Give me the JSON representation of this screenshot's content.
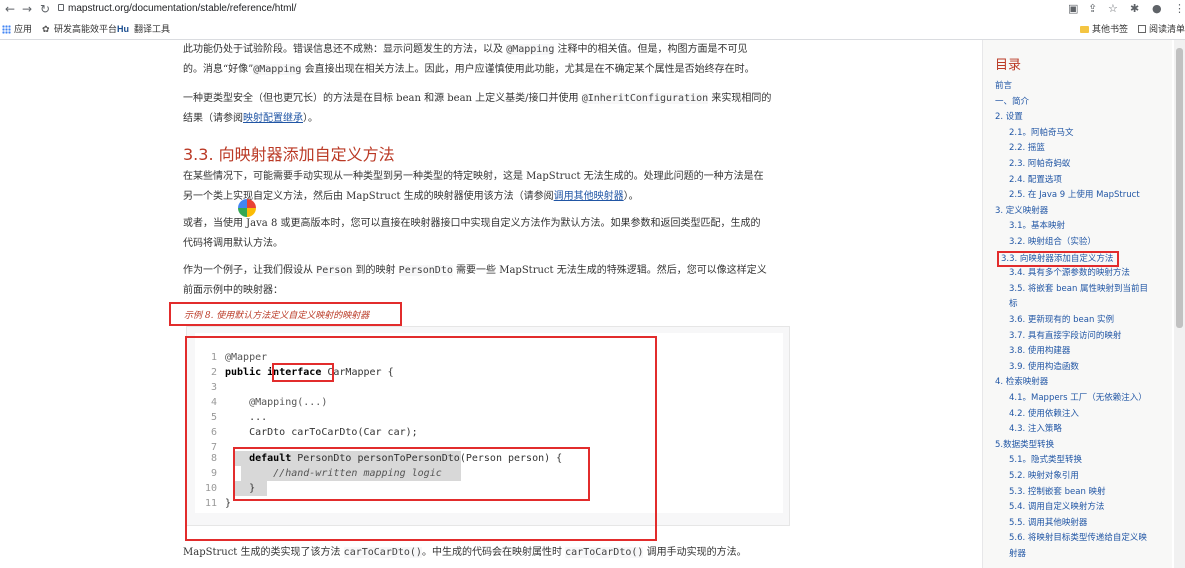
{
  "browser": {
    "url": "mapstruct.org/documentation/stable/reference/html/",
    "bookmarks": [
      "应用",
      "研发高能效平台",
      "Hu",
      "翻译工具"
    ],
    "bookmarks_right": [
      "其他书签",
      "阅读清单"
    ]
  },
  "content": {
    "para1_line1_a": "此功能仍处于试验阶段。错误信息还不成熟：显示问题发生的方法，以及 ",
    "para1_code1": "@Mapping",
    "para1_line1_b": " 注释中的相关值。但是，构图方面是不可见",
    "para1_line2_a": "的。消息“好像”",
    "para1_code2": "@Mapping",
    "para1_line2_b": " 会直接出现在相关方法上。因此，用户应谨慎使用此功能，尤其是在不确定某个属性是否始终存在时。",
    "para2_line1_a": "一种更类型安全（但也更冗长）的方法是在目标 bean 和源 bean 上定义基类/接口并使用 ",
    "para2_code": "@InheritConfiguration",
    "para2_line1_b": " 来实现相同的",
    "para2_line2_a": "结果（请参阅",
    "para2_link": "映射配置继承",
    "para2_line2_b": "）。",
    "heading": "3.3. 向映射器添加自定义方法",
    "para3_line1": "在某些情况下，可能需要手动实现从一种类型到另一种类型的特定映射，这是 MapStruct 无法生成的。处理此问题的一种方法是在",
    "para3_line2_a": "另一个类上实现自定义方法，然后由 MapStruct 生成的映射器使用该方法（请参阅",
    "para3_link": "调用其他映射器",
    "para3_line2_b": "）。",
    "para4_line1": "或者，当使用 Java 8 或更高版本时，您可以直接在映射器接口中实现自定义方法作为默认方法。如果参数和返回类型匹配，生成的",
    "para4_line2": "代码将调用默认方法。",
    "para5_line1_a": "作为一个例子，让我们假设从 ",
    "para5_code1": "Person",
    "para5_line1_b": " 到的映射 ",
    "para5_code2": "PersonDto",
    "para5_line1_c": " 需要一些 MapStruct 无法生成的特殊逻辑。然后，您可以像这样定义",
    "para5_line2": "前面示例中的映射器：",
    "example_title": "示例 8. 使用默认方法定义自定义映射的映射器",
    "code_lines": [
      {
        "n": "1",
        "t": "@Mapper"
      },
      {
        "n": "2",
        "a": "public ",
        "k": "interface",
        "b": " CarMapper {"
      },
      {
        "n": "3",
        "t": ""
      },
      {
        "n": "4",
        "t": "    @Mapping(...)"
      },
      {
        "n": "5",
        "t": "    ..."
      },
      {
        "n": "6",
        "t": "    CarDto carToCarDto(Car car);"
      },
      {
        "n": "7",
        "t": ""
      },
      {
        "n": "8",
        "a": "    ",
        "k": "default",
        "b": " PersonDto personToPersonDto(Person person) {"
      },
      {
        "n": "9",
        "c": "        //hand-written mapping logic"
      },
      {
        "n": "10",
        "t": "    }"
      },
      {
        "n": "11",
        "t": "}"
      }
    ],
    "para6_a": "MapStruct 生成的类实现了该方法 ",
    "para6_code1": "carToCarDto()",
    "para6_b": "。中生成的代码会在映射属性时 ",
    "para6_code2": "carToCarDto()",
    "para6_c": " 调用手动实现的方法。"
  },
  "toc": {
    "title": "目录",
    "items": [
      {
        "label": "前言",
        "level": 0
      },
      {
        "label": "一、简介",
        "level": 0
      },
      {
        "label": "2. 设置",
        "level": 0
      },
      {
        "label": "2.1。阿帕奇马文",
        "level": 1
      },
      {
        "label": "2.2. 摇篮",
        "level": 1
      },
      {
        "label": "2.3. 阿帕奇蚂蚁",
        "level": 1
      },
      {
        "label": "2.4. 配置选项",
        "level": 1
      },
      {
        "label": "2.5. 在 Java 9 上使用 MapStruct",
        "level": 1
      },
      {
        "label": "3. 定义映射器",
        "level": 0
      },
      {
        "label": "3.1。基本映射",
        "level": 1
      },
      {
        "label": "3.2. 映射组合（实验）",
        "level": 1
      },
      {
        "label": "3.3. 向映射器添加自定义方法",
        "level": 1,
        "active": true
      },
      {
        "label": "3.4. 具有多个源参数的映射方法",
        "level": 1
      },
      {
        "label": "3.5. 将嵌套 bean 属性映射到当前目",
        "level": 1
      },
      {
        "label": "标",
        "level": 1
      },
      {
        "label": "3.6. 更新现有的 bean 实例",
        "level": 1
      },
      {
        "label": "3.7. 具有直接字段访问的映射",
        "level": 1
      },
      {
        "label": "3.8. 使用构建器",
        "level": 1
      },
      {
        "label": "3.9. 使用构造函数",
        "level": 1
      },
      {
        "label": "4. 检索映射器",
        "level": 0
      },
      {
        "label": "4.1。Mappers 工厂（无依赖注入）",
        "level": 1
      },
      {
        "label": "4.2. 使用依赖注入",
        "level": 1
      },
      {
        "label": "4.3. 注入策略",
        "level": 1
      },
      {
        "label": "5.数据类型转换",
        "level": 0
      },
      {
        "label": "5.1。隐式类型转换",
        "level": 1
      },
      {
        "label": "5.2. 映射对象引用",
        "level": 1
      },
      {
        "label": "5.3. 控制嵌套 bean 映射",
        "level": 1
      },
      {
        "label": "5.4. 调用自定义映射方法",
        "level": 1
      },
      {
        "label": "5.5. 调用其他映射器",
        "level": 1
      },
      {
        "label": "5.6. 将映射目标类型传递给自定义映",
        "level": 1
      },
      {
        "label": "射器",
        "level": 1
      }
    ]
  }
}
